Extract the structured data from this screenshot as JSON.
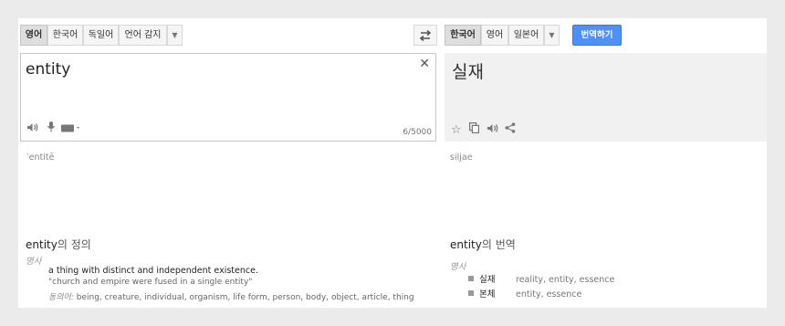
{
  "source_langs": [
    {
      "label": "영어",
      "active": true
    },
    {
      "label": "한국어",
      "active": false
    },
    {
      "label": "독일어",
      "active": false
    },
    {
      "label": "언어 감지",
      "active": false
    }
  ],
  "target_langs": [
    {
      "label": "한국어",
      "active": true
    },
    {
      "label": "영어",
      "active": false
    },
    {
      "label": "일본어",
      "active": false
    }
  ],
  "translate_label": "번역하기",
  "source": {
    "text": "entity",
    "char_count": "6/5000",
    "transliteration": "ˈentitē"
  },
  "target": {
    "text": "실재",
    "transliteration": "siljae"
  },
  "definitions": {
    "title_word": "entity",
    "title_suffix": "의 정의",
    "pos": "명사",
    "gloss": "a thing with distinct and independent existence.",
    "example": "\"church and empire were fused in a single entity\"",
    "synonyms_label": "동의어:",
    "synonyms": " being, creature, individual, organism, life form, person, body, object, article, thing"
  },
  "translations": {
    "title_word": "entity",
    "title_suffix": "의 번역",
    "pos": "명사",
    "rows": [
      {
        "word": "실재",
        "meanings": "reality, entity, essence"
      },
      {
        "word": "본체",
        "meanings": "entity, essence"
      }
    ]
  },
  "colors": {
    "accent": "#4d90fe",
    "background": "#ebebeb"
  },
  "icons": [
    "swap-icon",
    "close-icon",
    "speaker-icon",
    "mic-icon",
    "keyboard-icon",
    "star-icon",
    "copy-icon",
    "share-icon"
  ]
}
